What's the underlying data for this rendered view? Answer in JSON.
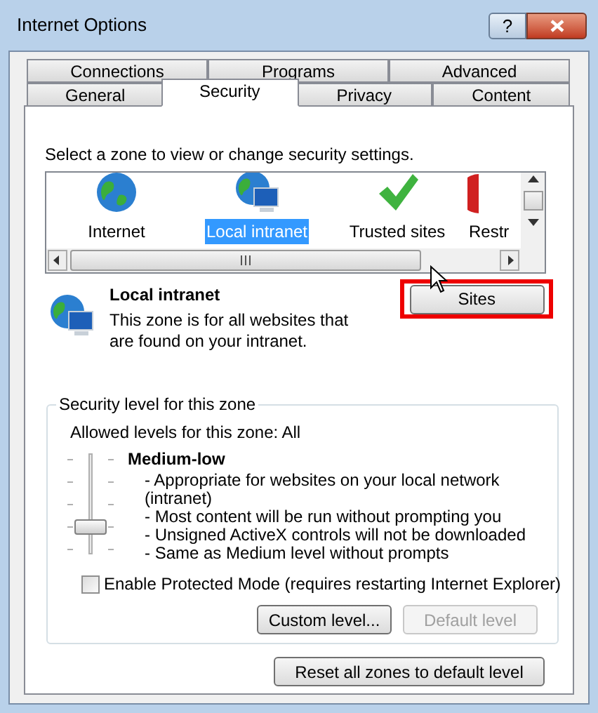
{
  "window": {
    "title": "Internet Options",
    "help_button": "?"
  },
  "tab_rows": [
    [
      {
        "label": "Connections",
        "selected": false
      },
      {
        "label": "Programs",
        "selected": false
      },
      {
        "label": "Advanced",
        "selected": false
      }
    ],
    [
      {
        "label": "General",
        "selected": false
      },
      {
        "label": "Security",
        "selected": true
      },
      {
        "label": "Privacy",
        "selected": false
      },
      {
        "label": "Content",
        "selected": false
      }
    ]
  ],
  "zone_prompt": "Select a zone to view or change security settings.",
  "zones": [
    {
      "label": "Internet",
      "kind": "globe",
      "selected": false
    },
    {
      "label": "Local intranet",
      "kind": "intranet",
      "selected": true
    },
    {
      "label": "Trusted sites",
      "kind": "check",
      "selected": false
    },
    {
      "label": "Restr",
      "kind": "restricted",
      "selected": false
    }
  ],
  "zone_info": {
    "title": "Local intranet",
    "description": "This zone is for all websites that are found on your intranet."
  },
  "sites_button": {
    "label": "Sites",
    "highlighted": true
  },
  "security_level": {
    "legend": "Security level for this zone",
    "allowed": "Allowed levels for this zone: All",
    "level": 0.25,
    "level_name": "Medium-low",
    "bullets": [
      "- Appropriate for websites on your local network",
      "(intranet)",
      "- Most content will be run without prompting you",
      "- Unsigned ActiveX controls will not be downloaded",
      "- Same as Medium level without prompts"
    ],
    "protected_mode": {
      "label": "Enable Protected Mode (requires restarting Internet Explorer)",
      "checked": false
    },
    "buttons": [
      {
        "label": "Custom level...",
        "disabled": false
      },
      {
        "label": "Default level",
        "disabled": true
      }
    ]
  },
  "reset_button": {
    "label": "Reset all zones to default level"
  }
}
